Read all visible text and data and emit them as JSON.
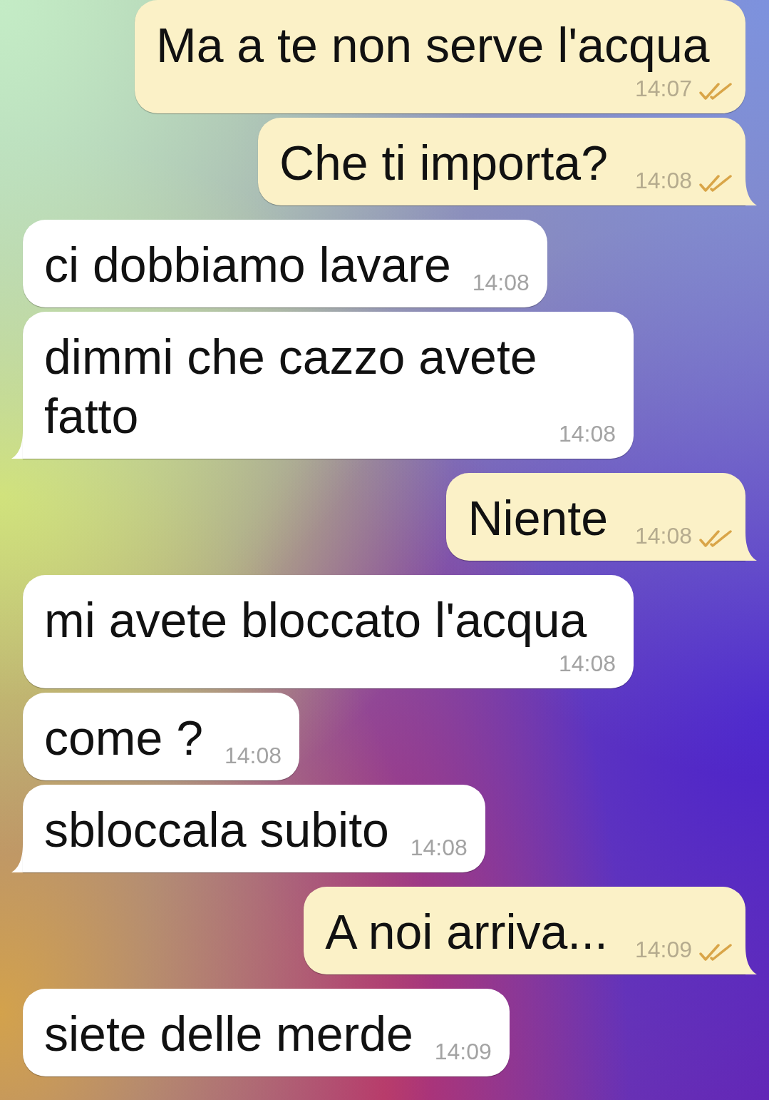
{
  "messages": [
    {
      "kind": "outgoing",
      "text": "Ma a te non serve l'acqua",
      "time": "14:07",
      "read": true,
      "tail": false
    },
    {
      "kind": "outgoing",
      "text": "Che ti importa?",
      "time": "14:08",
      "read": true,
      "tail": true
    },
    {
      "kind": "incoming",
      "text": "ci dobbiamo lavare",
      "time": "14:08",
      "tail": false
    },
    {
      "kind": "incoming",
      "text": "dimmi che cazzo avete fatto",
      "time": "14:08",
      "tail": true
    },
    {
      "kind": "outgoing",
      "text": "Niente",
      "time": "14:08",
      "read": true,
      "tail": true
    },
    {
      "kind": "incoming",
      "text": "mi avete bloccato l'acqua",
      "time": "14:08",
      "tail": false
    },
    {
      "kind": "incoming",
      "text": "come ?",
      "time": "14:08",
      "tail": false
    },
    {
      "kind": "incoming",
      "text": "sbloccala subito",
      "time": "14:08",
      "tail": true
    },
    {
      "kind": "outgoing",
      "text": "A noi arriva...",
      "time": "14:09",
      "read": true,
      "tail": true
    },
    {
      "kind": "incoming",
      "text": "siete delle merde",
      "time": "14:09",
      "tail": false
    }
  ]
}
